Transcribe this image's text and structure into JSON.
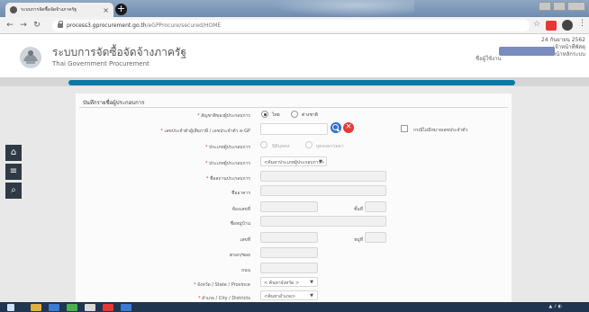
{
  "browser": {
    "tab_title": "ระบบการจัดซื้อจัดจ้างภาครัฐ",
    "url_host": "process3.gprocurement.go.th",
    "url_path": "/eGPProcure/secured/HOME"
  },
  "site": {
    "title": "ระบบการจัดซื้อจัดจ้างภาครัฐ",
    "subtitle": "Thai Government Procurement",
    "date": "24 กันยายน 2562",
    "header_right_line": "เจ้าหน้าที่พัสดุ",
    "header_left_line": "ชื่อผู้ใช้งาน",
    "header_right_line2": "หน้าหลักระบบ"
  },
  "form": {
    "title": "บันทึกรายชื่อผู้ประกอบการ",
    "nationality_label": "สัญชาติของผู้ประกอบการ",
    "nationality_options": [
      "ไทย",
      "ต่างชาติ"
    ],
    "taxid_label": "เลขประจำตัวผู้เสียภาษี / เลขประจำตัว e-GP",
    "no_taxid_label": "กรณีไม่มีหมายเลขประจำตัว",
    "person_type_label": "ประเภทผู้ประกอบการ",
    "person_type_options": [
      "นิติบุคคล",
      "บุคคลธรรมดา"
    ],
    "vendor_type_label": "ประเภทผู้ประกอบการ",
    "vendor_type_select": "<ค้นหาประเภทผู้ประกอบการ>",
    "name_label": "ชื่อสถานประกอบการ",
    "building_label": "ชื่ออาคาร",
    "room_label": "ห้องเลขที่",
    "floor_label": "ชั้นที่",
    "village_label": "ชื่อหมู่บ้าน",
    "number_label": "เลขที่",
    "moo_label": "หมู่ที่",
    "soi_label": "ตรอก/ซอย",
    "road_label": "ถนน",
    "province_label": "จังหวัด / State / Province",
    "province_select": "< ค้นหาจังหวัด >",
    "district_label": "อำเภอ / City / Districts",
    "district_select": "<ค้นหาอำเภอ>"
  }
}
